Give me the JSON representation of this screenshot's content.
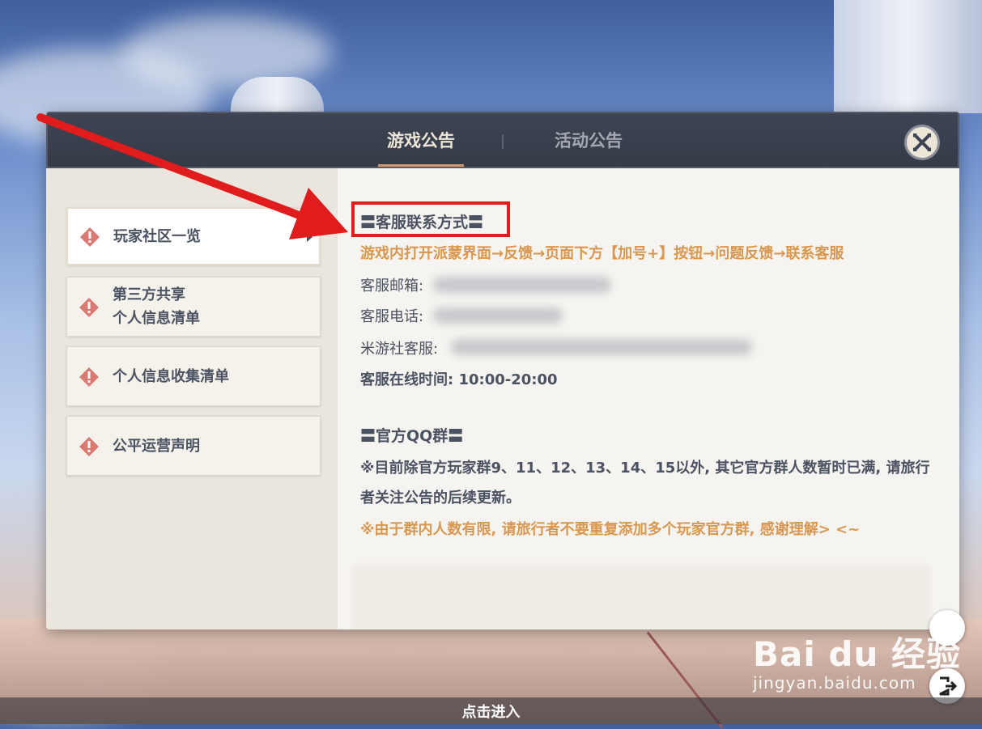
{
  "tabs": [
    {
      "label": "游戏公告",
      "active": true
    },
    {
      "label": "活动公告",
      "active": false
    }
  ],
  "close_icon": "close-icon",
  "sidebar": {
    "items": [
      {
        "label": "玩家社区一览",
        "active": true,
        "icon": "warning-diamond-icon"
      },
      {
        "label": "第三方共享",
        "label2": "个人信息清单",
        "active": false,
        "icon": "warning-diamond-icon"
      },
      {
        "label": "个人信息收集清单",
        "active": false,
        "icon": "warning-diamond-icon"
      },
      {
        "label": "公平运营声明",
        "active": false,
        "icon": "warning-diamond-icon"
      }
    ]
  },
  "content": {
    "cs_heading": "〓客服联系方式〓",
    "cs_instruction": "游戏内打开派蒙界面→反馈→页面下方【加号+】按钮→问题反馈→联系客服",
    "email_label": "客服邮箱:",
    "phone_label": "客服电话:",
    "miyoushe_label": "米游社客服:",
    "hours_text": "客服在线时间: 10:00-20:00",
    "qq_heading": "〓官方QQ群〓",
    "qq_note_1": "※目前除官方玩家群9、11、12、13、14、15以外, 其它官方群人数暂时已满, 请旅行",
    "qq_note_2": "者关注公告的后续更新。",
    "qq_note_3": "※由于群内人数有限, 请旅行者不要重复添加多个玩家官方群, 感谢理解> <~"
  },
  "footer": {
    "enter_label": "点击进入"
  },
  "watermark": {
    "main": "Bai du 经验",
    "sub": "jingyan.baidu.com"
  },
  "colors": {
    "accent_orange": "#d9974f",
    "annotation_red": "#e01c1c",
    "text_dark": "#4b5262"
  }
}
